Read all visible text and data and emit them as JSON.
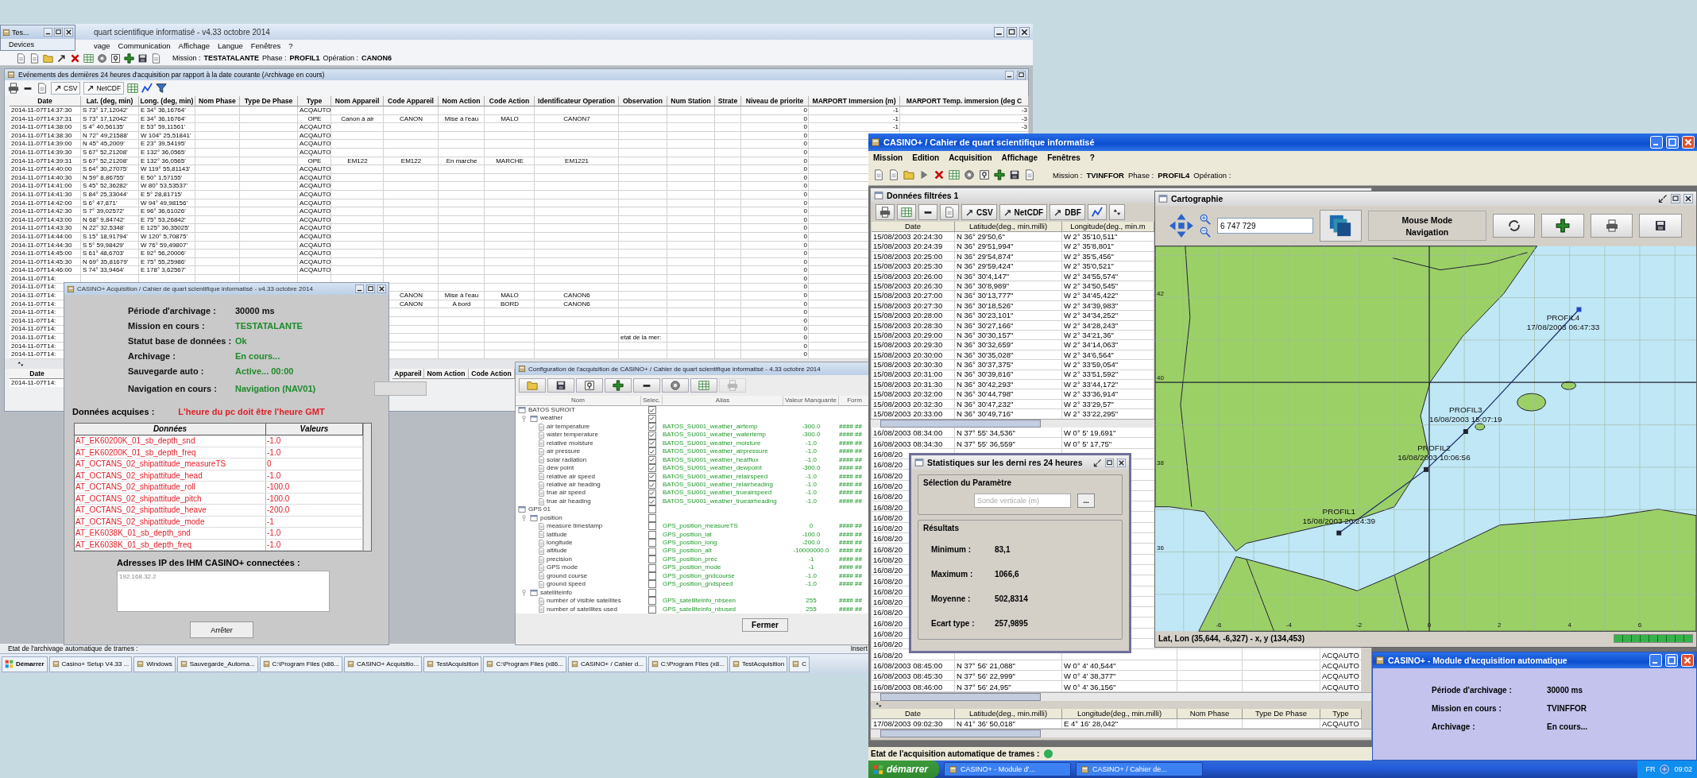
{
  "left_desktop": {
    "main_window": {
      "title": "quart scientifique informatisé - v4.33 octobre 2014",
      "menu": [
        "vage",
        "Communication",
        "Affichage",
        "Langue",
        "Fenêtres",
        "?"
      ],
      "status": [
        {
          "label": "Mission :",
          "value": "TESTATALANTE"
        },
        {
          "label": "Phase :",
          "value": "PROFIL1"
        },
        {
          "label": "Opération :",
          "value": "CANON6"
        }
      ]
    },
    "small_window": {
      "title": "Tes...",
      "label": "Devices"
    },
    "events_window": {
      "title": "Evénements des dernières 24 heures d'acquisition par rapport à la date courante (Archivage en cours)",
      "tools": [
        "CSV",
        "NetCDF"
      ],
      "columns": [
        "Date",
        "Lat. (deg, min)",
        "Long. (deg, min)",
        "Nom Phase",
        "Type De Phase",
        "Type",
        "Nom Appareil",
        "Code Appareil",
        "Nom Action",
        "Code Action",
        "Identificateur Operation",
        "Observation",
        "Num Station",
        "Strate",
        "Niveau de priorite",
        "MARPORT Immersion (m)",
        "MARPORT Temp. immersion (deg C"
      ],
      "rows": [
        {
          "date": "2014-11-07T14:37:30",
          "lat": "S 73° 17,12042'",
          "lon": "E 34° 36,16764'",
          "type": "ACQAUTO",
          "niveau": "0",
          "immersion": "-1",
          "temp": "-3"
        },
        {
          "date": "2014-11-07T14:37:31",
          "lat": "S 73° 17,12042'",
          "lon": "E 34° 36,16764'",
          "type": "OPE",
          "nom_appareil": "Canon à air",
          "code_appareil": "CANON",
          "nom_action": "Mise à l'eau",
          "code_action": "MALO",
          "identificateur": "CANON7",
          "niveau": "0",
          "immersion": "-1",
          "temp": "-3"
        },
        {
          "date": "2014-11-07T14:38:00",
          "lat": "S 4° 40,56135'",
          "lon": "E 53° 59,11561'",
          "type": "ACQAUTO",
          "niveau": "0",
          "immersion": "-1",
          "temp": "-3"
        },
        {
          "date": "2014-11-07T14:38:30",
          "lat": "N 72° 49,21588'",
          "lon": "W 104° 25,51841'",
          "type": "ACQAUTO",
          "niveau": "0"
        },
        {
          "date": "2014-11-07T14:39:00",
          "lat": "N 45° 45,2009'",
          "lon": "E 23° 39,54195'",
          "type": "ACQAUTO",
          "niveau": "0"
        },
        {
          "date": "2014-11-07T14:39:30",
          "lat": "S 67° 52,21208'",
          "lon": "E 132° 36,0565'",
          "type": "ACQAUTO",
          "niveau": "0"
        },
        {
          "date": "2014-11-07T14:39:31",
          "lat": "S 67° 52,21208'",
          "lon": "E 132° 36,0565'",
          "type": "OPE",
          "nom_appareil": "EM122",
          "code_appareil": "EM122",
          "nom_action": "En marche",
          "code_action": "MARCHE",
          "identificateur": "EM1221",
          "niveau": "0"
        },
        {
          "date": "2014-11-07T14:40:00",
          "lat": "S 64° 30,27075'",
          "lon": "W 119° 55,81143'",
          "type": "ACQAUTO",
          "niveau": "0"
        },
        {
          "date": "2014-11-07T14:40:30",
          "lat": "N 59° 8,86755'",
          "lon": "E 50° 1,57155'",
          "type": "ACQAUTO",
          "niveau": "0"
        },
        {
          "date": "2014-11-07T14:41:00",
          "lat": "S 45° 52,36282'",
          "lon": "W 80° 53,53537'",
          "type": "ACQAUTO",
          "niveau": "0"
        },
        {
          "date": "2014-11-07T14:41:30",
          "lat": "S 84° 25,33044'",
          "lon": "E 5° 28,81715'",
          "type": "ACQAUTO",
          "niveau": "0"
        },
        {
          "date": "2014-11-07T14:42:00",
          "lat": "S 6° 47,871'",
          "lon": "W 94° 49,98156'",
          "type": "ACQAUTO",
          "niveau": "0"
        },
        {
          "date": "2014-11-07T14:42:30",
          "lat": "S 7° 39,02572'",
          "lon": "E 96° 36,61026'",
          "type": "ACQAUTO",
          "niveau": "0"
        },
        {
          "date": "2014-11-07T14:43:00",
          "lat": "N 68° 9,84742'",
          "lon": "E 75° 53,26842'",
          "type": "ACQAUTO",
          "niveau": "0"
        },
        {
          "date": "2014-11-07T14:43:30",
          "lat": "N 22° 32,5348'",
          "lon": "E 125° 36,35025'",
          "type": "ACQAUTO",
          "niveau": "0"
        },
        {
          "date": "2014-11-07T14:44:00",
          "lat": "S 15° 18,91794'",
          "lon": "W 120° 5,70875'",
          "type": "ACQAUTO",
          "niveau": "0"
        },
        {
          "date": "2014-11-07T14:44:30",
          "lat": "S 5° 59,98429'",
          "lon": "W 76° 59,49807'",
          "type": "ACQAUTO",
          "niveau": "0"
        },
        {
          "date": "2014-11-07T14:45:00",
          "lat": "S 61° 48,6703'",
          "lon": "E 92° 56,20006'",
          "type": "ACQAUTO",
          "niveau": "0"
        },
        {
          "date": "2014-11-07T14:45:30",
          "lat": "N 69° 35,81679'",
          "lon": "E 75° 55,25986'",
          "type": "ACQAUTO",
          "niveau": "0"
        },
        {
          "date": "2014-11-07T14:46:00",
          "lat": "S 74° 33,9464'",
          "lon": "E 178° 3,62567'",
          "type": "ACQAUTO",
          "niveau": "0"
        },
        {
          "date": "2014-11-07T14:",
          "niveau": "0"
        },
        {
          "date": "2014-11-07T14:",
          "niveau": "0"
        },
        {
          "date": "2014-11-07T14:",
          "code_appareil": "CANON",
          "nom_action": "Mise à l'eau",
          "code_action": "MALO",
          "identificateur": "CANON6",
          "niveau": "0"
        },
        {
          "date": "2014-11-07T14:",
          "code_appareil": "CANON",
          "nom_action": "A bord",
          "code_action": "BORD",
          "identificateur": "CANON6",
          "niveau": "0"
        },
        {
          "date": "2014-11-07T14:",
          "niveau": "0"
        },
        {
          "date": "2014-11-07T14:",
          "niveau": "0"
        },
        {
          "date": "2014-11-07T14:",
          "niveau": "0"
        },
        {
          "date": "2014-11-07T14:",
          "observation": "etat de la mer:",
          "niveau": "0"
        },
        {
          "date": "2014-11-07T14:",
          "niveau": "0"
        },
        {
          "date": "2014-11-07T14:",
          "niveau": "0"
        }
      ],
      "lower_pane": {
        "columns": [
          "Date",
          "Appareil",
          "Nom Action",
          "Code Action"
        ],
        "rows": [
          "2014-11-07T14:"
        ]
      }
    },
    "acquisition_dialog": {
      "title": "CASINO+ Acquisition / Cahier de quart scientifique informatisé - v4.33 octobre 2014",
      "fields": [
        {
          "label": "Période d'archivage :",
          "value": "30000 ms",
          "kind": "plain"
        },
        {
          "label": "Mission en cours :",
          "value": "TESTATALANTE",
          "kind": "ok"
        },
        {
          "label": "Statut base de données :",
          "value": "Ok",
          "kind": "ok"
        },
        {
          "label": "Archivage :",
          "value": "En cours...",
          "kind": "ok"
        },
        {
          "label": "Sauvegarde auto :",
          "value": "Active... 00:00",
          "kind": "ok"
        },
        {
          "label": "Navigation en cours :",
          "value": "Navigation (NAV01)",
          "kind": "ok"
        }
      ],
      "data_label": "Données acquises :",
      "warning": "L'heure du pc doit être l'heure GMT",
      "table": {
        "columns": [
          "Données",
          "Valeurs"
        ],
        "rows": [
          [
            "AT_EK60200K_01_sb_depth_snd",
            "-1.0"
          ],
          [
            "AT_EK60200K_01_sb_depth_freq",
            "-1.0"
          ],
          [
            "AT_OCTANS_02_shipattitude_measureTS",
            "0"
          ],
          [
            "AT_OCTANS_02_shipattitude_head",
            "-1.0"
          ],
          [
            "AT_OCTANS_02_shipattitude_roll",
            "-100.0"
          ],
          [
            "AT_OCTANS_02_shipattitude_pitch",
            "-100.0"
          ],
          [
            "AT_OCTANS_02_shipattitude_heave",
            "-200.0"
          ],
          [
            "AT_OCTANS_02_shipattitude_mode",
            "-1"
          ],
          [
            "AT_EK6038K_01_sb_depth_snd",
            "-1.0"
          ],
          [
            "AT_EK6038K_01_sb_depth_freq",
            "-1.0"
          ]
        ]
      },
      "ip_label": "Adresses IP des IHM CASINO+ connectées :",
      "ip_value": "192.168.32.2",
      "stop_button": "Arrêter"
    },
    "config_dialog": {
      "title": "Configuration de l'acquisition de CASINO+ / Cahier de quart scientifique informatisé - 4.33 octobre 2014",
      "toolbar": [
        {
          "disabled": false
        },
        {
          "disabled": false
        },
        {
          "disabled": false
        },
        {
          "disabled": false
        },
        {
          "disabled": false
        },
        {
          "disabled": false
        },
        {
          "disabled": false
        },
        {
          "disabled": true
        }
      ],
      "columns": [
        "Nom",
        "Selec.",
        "Alias",
        "Valeur Manquante",
        "Form"
      ],
      "tree": [
        {
          "name": "BATOS SUROIT",
          "checked": true,
          "children": [
            {
              "name": "weather",
              "checked": true,
              "expanded": true,
              "children": [
                {
                  "name": "air temperature",
                  "checked": true,
                  "alias": "BATOS_SU001_weather_airtemp",
                  "missing": "-300.0",
                  "format": "#### ##"
                },
                {
                  "name": "water temperature",
                  "checked": true,
                  "alias": "BATOS_SU001_weather_watertemp",
                  "missing": "-300.0",
                  "format": "#### ##"
                },
                {
                  "name": "relative moisture",
                  "checked": true,
                  "alias": "BATOS_SU001_weather_moisture",
                  "missing": "-1.0",
                  "format": "#### ##"
                },
                {
                  "name": "air pressure",
                  "checked": true,
                  "alias": "BATOS_SU001_weather_airpressure",
                  "missing": "-1.0",
                  "format": "#### ##"
                },
                {
                  "name": "solar radiation",
                  "checked": true,
                  "alias": "BATOS_SU001_weather_heatflux",
                  "missing": "-1.0",
                  "format": "#### ##"
                },
                {
                  "name": "dew point",
                  "checked": true,
                  "alias": "BATOS_SU001_weather_dewpoint",
                  "missing": "-300.0",
                  "format": "#### ##"
                },
                {
                  "name": "relative air speed",
                  "checked": true,
                  "alias": "BATOS_SU001_weather_relairspeed",
                  "missing": "-1.0",
                  "format": "#### ##"
                },
                {
                  "name": "relative air heading",
                  "checked": true,
                  "alias": "BATOS_SU001_weather_relairheading",
                  "missing": "-1.0",
                  "format": "#### ##"
                },
                {
                  "name": "true air speed",
                  "checked": true,
                  "alias": "BATOS_SU001_weather_trueairspeed",
                  "missing": "-1.0",
                  "format": "#### ##"
                },
                {
                  "name": "true air heading",
                  "checked": true,
                  "alias": "BATOS_SU001_weather_trueairheading",
                  "missing": "-1.0",
                  "format": "#### ##"
                }
              ]
            }
          ]
        },
        {
          "name": "GPS 01",
          "checked": false,
          "children": [
            {
              "name": "position",
              "checked": false,
              "expanded": true,
              "children": [
                {
                  "name": "measure timestamp",
                  "checked": false,
                  "alias": "GPS_position_measureTS",
                  "missing": "0",
                  "format": "#### ##"
                },
                {
                  "name": "latitude",
                  "checked": false,
                  "alias": "GPS_position_lat",
                  "missing": "-100.0",
                  "format": "#### ##"
                },
                {
                  "name": "longitude",
                  "checked": false,
                  "alias": "GPS_position_long",
                  "missing": "-200.0",
                  "format": "#### ##"
                },
                {
                  "name": "altitude",
                  "checked": false,
                  "alias": "GPS_position_alt",
                  "missing": "-10000000.0",
                  "format": "#### ##"
                },
                {
                  "name": "precision",
                  "checked": false,
                  "alias": "GPS_position_prec",
                  "missing": "-1",
                  "format": "#### ##"
                },
                {
                  "name": "GPS mode",
                  "checked": false,
                  "alias": "GPS_position_mode",
                  "missing": "-1",
                  "format": "#### ##"
                },
                {
                  "name": "ground course",
                  "checked": false,
                  "alias": "GPS_position_gndcourse",
                  "missing": "-1.0",
                  "format": "#### ##"
                },
                {
                  "name": "ground speed",
                  "checked": false,
                  "alias": "GPS_position_gndspeed",
                  "missing": "-1.0",
                  "format": "#### ##"
                }
              ]
            },
            {
              "name": "satelliteinfo",
              "checked": false,
              "expanded": true,
              "children": [
                {
                  "name": "number of visible satellites",
                  "checked": false,
                  "alias": "GPS_satelliteinfo_nbseen",
                  "missing": "255",
                  "format": "#### ##"
                },
                {
                  "name": "number of satellites used",
                  "checked": false,
                  "alias": "GPS_satelliteinfo_nbused",
                  "missing": "255",
                  "format": "#### ##"
                }
              ]
            }
          ]
        }
      ],
      "close_button": "Fermer"
    },
    "status_text": "Etat de l'archivage automatique de trames :",
    "insert_label": "Insert",
    "taskbar": {
      "start": "Démarrer",
      "items": [
        "Casino+ Setup V4.33 ...",
        "Windows",
        "Sauvegarde_Automa...",
        "C:\\Program Files (x86...",
        "CASINO+ Acquisitio...",
        "TestAcquisition",
        "C:\\Program Files (x86...",
        "CASINO+ / Cahier d...",
        "C:\\Program Files (x8...",
        "TestAcquisition",
        "C"
      ]
    }
  },
  "right_desktop": {
    "main_window": {
      "title": "CASINO+ / Cahier de quart scientifique informatisé",
      "menu": [
        "Mission",
        "Edition",
        "Acquisition",
        "Affichage",
        "Fenêtres",
        "?"
      ],
      "status": [
        {
          "label": "Mission :",
          "value": "TVINFFOR"
        },
        {
          "label": "Phase :",
          "value": "PROFIL4"
        },
        {
          "label": "Opération :"
        }
      ]
    },
    "data_window": {
      "title": "Données filtrées 1",
      "tools": [
        "CSV",
        "NetCDF",
        "DBF"
      ],
      "columns": [
        "Date",
        "Latitude(deg., min.milli)",
        "Longitude(deg., min.m"
      ],
      "rows": [
        {
          "date": "15/08/2003 20:24:30",
          "lat": "N 36° 29'50,6\"",
          "lon": "W 2° 35'10,511\""
        },
        {
          "date": "15/08/2003 20:24:39",
          "lat": "N 36° 29'51,994\"",
          "lon": "W 2° 35'8,801\""
        },
        {
          "date": "15/08/2003 20:25:00",
          "lat": "N 36° 29'54,874\"",
          "lon": "W 2° 35'5,456\""
        },
        {
          "date": "15/08/2003 20:25:30",
          "lat": "N 36° 29'59,424\"",
          "lon": "W 2° 35'0,521\""
        },
        {
          "date": "15/08/2003 20:26:00",
          "lat": "N 36° 30'4,147\"",
          "lon": "W 2° 34'55,574\""
        },
        {
          "date": "15/08/2003 20:26:30",
          "lat": "N 36° 30'8,989\"",
          "lon": "W 2° 34'50,545\""
        },
        {
          "date": "15/08/2003 20:27:00",
          "lat": "N 36° 30'13,777\"",
          "lon": "W 2° 34'45,422\""
        },
        {
          "date": "15/08/2003 20:27:30",
          "lat": "N 36° 30'18,526\"",
          "lon": "W 2° 34'39,983\""
        },
        {
          "date": "15/08/2003 20:28:00",
          "lat": "N 36° 30'23,101\"",
          "lon": "W 2° 34'34,252\""
        },
        {
          "date": "15/08/2003 20:28:30",
          "lat": "N 36° 30'27,166\"",
          "lon": "W 2° 34'28,243\""
        },
        {
          "date": "15/08/2003 20:29:00",
          "lat": "N 36° 30'30,157\"",
          "lon": "W 2° 34'21,36\""
        },
        {
          "date": "15/08/2003 20:29:30",
          "lat": "N 36° 30'32,659\"",
          "lon": "W 2° 34'14,063\""
        },
        {
          "date": "15/08/2003 20:30:00",
          "lat": "N 36° 30'35,028\"",
          "lon": "W 2° 34'6,564\""
        },
        {
          "date": "15/08/2003 20:30:30",
          "lat": "N 36° 30'37,375\"",
          "lon": "W 2° 33'59,054\""
        },
        {
          "date": "15/08/2003 20:31:00",
          "lat": "N 36° 30'39,816\"",
          "lon": "W 2° 33'51,592\""
        },
        {
          "date": "15/08/2003 20:31:30",
          "lat": "N 36° 30'42,293\"",
          "lon": "W 2° 33'44,172\""
        },
        {
          "date": "15/08/2003 20:32:00",
          "lat": "N 36° 30'44,798\"",
          "lon": "W 2° 33'36,914\""
        },
        {
          "date": "15/08/2003 20:32:30",
          "lat": "N 36° 30'47,232\"",
          "lon": "W 2° 33'29,57\""
        },
        {
          "date": "15/08/2003 20:33:00",
          "lat": "N 36° 30'49,716\"",
          "lon": "W 2° 33'22,295\""
        }
      ],
      "rows_lower": [
        {
          "date": "16/08/2003 08:34:00",
          "lat": "N 37° 55' 34,536\"",
          "lon": "W 0° 5' 19,691\""
        },
        {
          "date": "16/08/2003 08:34:30",
          "lat": "N 37° 55' 36,559\"",
          "lon": "W 0° 5' 17,75\""
        },
        {
          "date": "16/08/20"
        },
        {
          "date": "16/08/20"
        },
        {
          "date": "16/08/20"
        },
        {
          "date": "16/08/20"
        },
        {
          "date": "16/08/20"
        },
        {
          "date": "16/08/20"
        },
        {
          "date": "16/08/20"
        },
        {
          "date": "16/08/20"
        },
        {
          "date": "16/08/20"
        },
        {
          "date": "16/08/20"
        },
        {
          "date": "16/08/20"
        },
        {
          "date": "16/08/20"
        },
        {
          "date": "16/08/20"
        },
        {
          "date": "16/08/20"
        },
        {
          "date": "16/08/20"
        },
        {
          "date": "16/08/20"
        },
        {
          "date": "16/08/20"
        },
        {
          "date": "16/08/20"
        },
        {
          "date": "16/08/20"
        },
        {
          "date": "16/08/20",
          "type": "ACQAUTO"
        },
        {
          "date": "16/08/2003 08:45:00",
          "lat": "N 37° 56' 21,088\"",
          "lon": "W 0° 4' 40,544\"",
          "type": "ACQAUTO"
        },
        {
          "date": "16/08/2003 08:45:30",
          "lat": "N 37° 56' 22,999\"",
          "lon": "W 0° 4' 38,377\"",
          "type": "ACQAUTO"
        },
        {
          "date": "16/08/2003 08:46:00",
          "lat": "N 37° 56' 24,95\"",
          "lon": "W 0° 4' 36,156\"",
          "type": "ACQAUTO"
        }
      ],
      "bottom_pane": {
        "columns": [
          "Date",
          "Latitude(deg., min.milli)",
          "Longitude(deg., min.milli)",
          "Nom Phase",
          "Type De Phase",
          "Type"
        ],
        "rows": [
          {
            "date": "17/08/2003 09:02:30",
            "lat": "N 41° 36' 50,018\"",
            "lon": "E 4° 16' 28,042\"",
            "type": "ACQAUTO"
          }
        ]
      }
    },
    "map_window": {
      "title": "Cartographie",
      "scale_value": "6 747 729",
      "mouse_mode": {
        "label": "Mouse Mode",
        "value": "Navigation"
      },
      "lat_ticks": [
        "42",
        "40",
        "38",
        "36"
      ],
      "lon_ticks": [
        "-6",
        "-4",
        "-2",
        "0",
        "2",
        "4",
        "6"
      ],
      "waypoints": [
        {
          "name": "PROFIL4",
          "time": "17/08/2003 06:47:33"
        },
        {
          "name": "PROFIL3",
          "time": "16/08/2003 15:07:19"
        },
        {
          "name": "PROFIL2",
          "time": "16/08/2003 10:06:56"
        },
        {
          "name": "PROFIL1",
          "time": "15/08/2003 20:24:39"
        }
      ],
      "status": "Lat, Lon (35,644, -6,327) - x, y (134,453)",
      "progress": {
        "level": 1
      }
    },
    "stats_window": {
      "title": "Statistiques sur les derni res 24 heures",
      "param_group": "Sélection du Paramètre",
      "param_value": "Sonde verticale (m)",
      "browse_button": "...",
      "results_group": "Résultats",
      "results": [
        {
          "label": "Minimum :",
          "value": "83,1"
        },
        {
          "label": "Maximum :",
          "value": "1066,6"
        },
        {
          "label": "Moyenne :",
          "value": "502,8314"
        },
        {
          "label": "Ecart type :",
          "value": "257,9895"
        }
      ]
    },
    "module_window": {
      "title": "CASINO+ - Module d'acquisition automatique",
      "fields": [
        {
          "label": "Période d'archivage :",
          "value": "30000 ms"
        },
        {
          "label": "Mission en cours :",
          "value": "TVINFFOR"
        },
        {
          "label": "Archivage :",
          "value": "En cours..."
        }
      ]
    },
    "status_text": "Etat de l'acquisition automatique de trames :",
    "indicator": {
      "on": true
    },
    "taskbar": {
      "start": "démarrer",
      "items": [
        "CASINO+ - Module d'...",
        "CASINO+ / Cahier de..."
      ],
      "language": "FR",
      "clock": "09:02"
    }
  }
}
